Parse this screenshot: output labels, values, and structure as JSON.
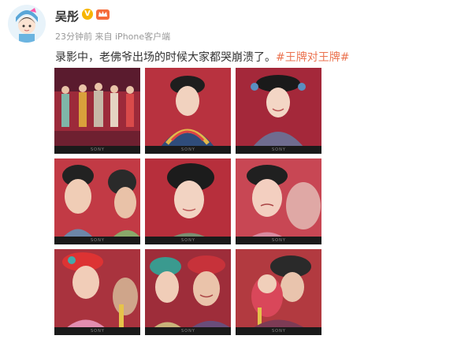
{
  "post": {
    "username": "吴彤",
    "verified_badge": "V",
    "timestamp": "23分钟前",
    "source_prefix": "来自",
    "source": "iPhone客户端",
    "text_main": "录影中，老佛爷出场的时候大家都哭崩溃了。",
    "hashtag": "#王牌对王牌#"
  },
  "photos": [
    {
      "name": "photo-stage-group",
      "tv_brand": "SONY"
    },
    {
      "name": "photo-actress-collar",
      "tv_brand": "SONY"
    },
    {
      "name": "photo-actress-smile",
      "tv_brand": "SONY"
    },
    {
      "name": "photo-two-faces",
      "tv_brand": "SONY"
    },
    {
      "name": "photo-actress-closeup",
      "tv_brand": "SONY"
    },
    {
      "name": "photo-crying-actress",
      "tv_brand": "SONY"
    },
    {
      "name": "photo-headdress-pair",
      "tv_brand": "SONY"
    },
    {
      "name": "photo-elder-woman",
      "tv_brand": "SONY"
    },
    {
      "name": "photo-embrace",
      "tv_brand": "SONY"
    }
  ],
  "colors": {
    "hashtag": "#eb7350",
    "badge": "#f7b500",
    "meta": "#999999"
  }
}
